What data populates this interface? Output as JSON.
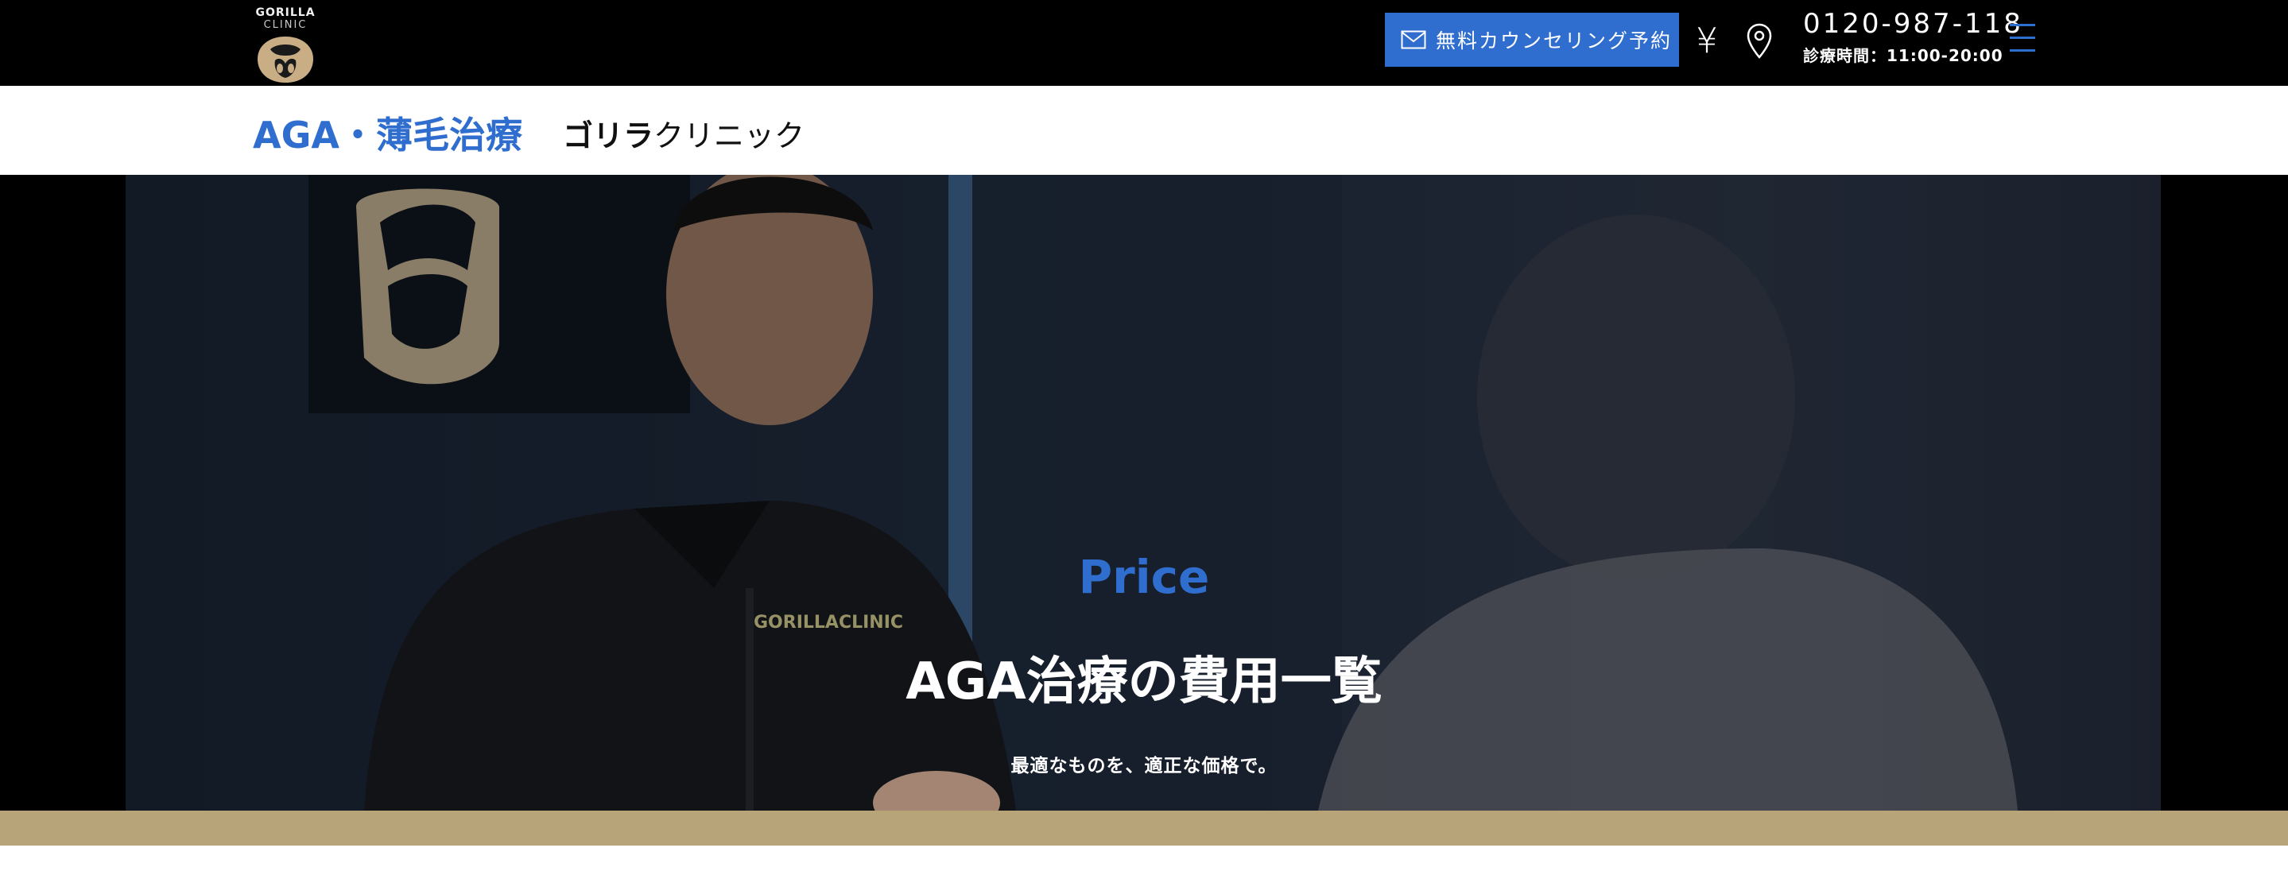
{
  "header": {
    "logo": {
      "line1": "GORILLA",
      "line2": "CLINIC",
      "icon": "gorilla-logo-icon"
    },
    "cta": {
      "label": "無料カウンセリング予約",
      "icon": "mail-icon",
      "color": "#2f6dce"
    },
    "price_icon": "¥",
    "location_icon": "map-pin-icon",
    "phone": "0120-987-118",
    "hours": "診療時間：11:00-20:00",
    "menu_icon": "hamburger-menu-icon"
  },
  "titlebar": {
    "service_title": "AGA・薄毛治療",
    "clinic_name_bold": "ゴリラ",
    "clinic_name_rest": "クリニック"
  },
  "hero": {
    "eyebrow": "Price",
    "title": "AGA治療の費用一覧",
    "subtitle": "最適なものを、適正な価格で。"
  },
  "colors": {
    "accent": "#2f6dce",
    "topbar": "#000000",
    "gold": "#b8a479"
  }
}
